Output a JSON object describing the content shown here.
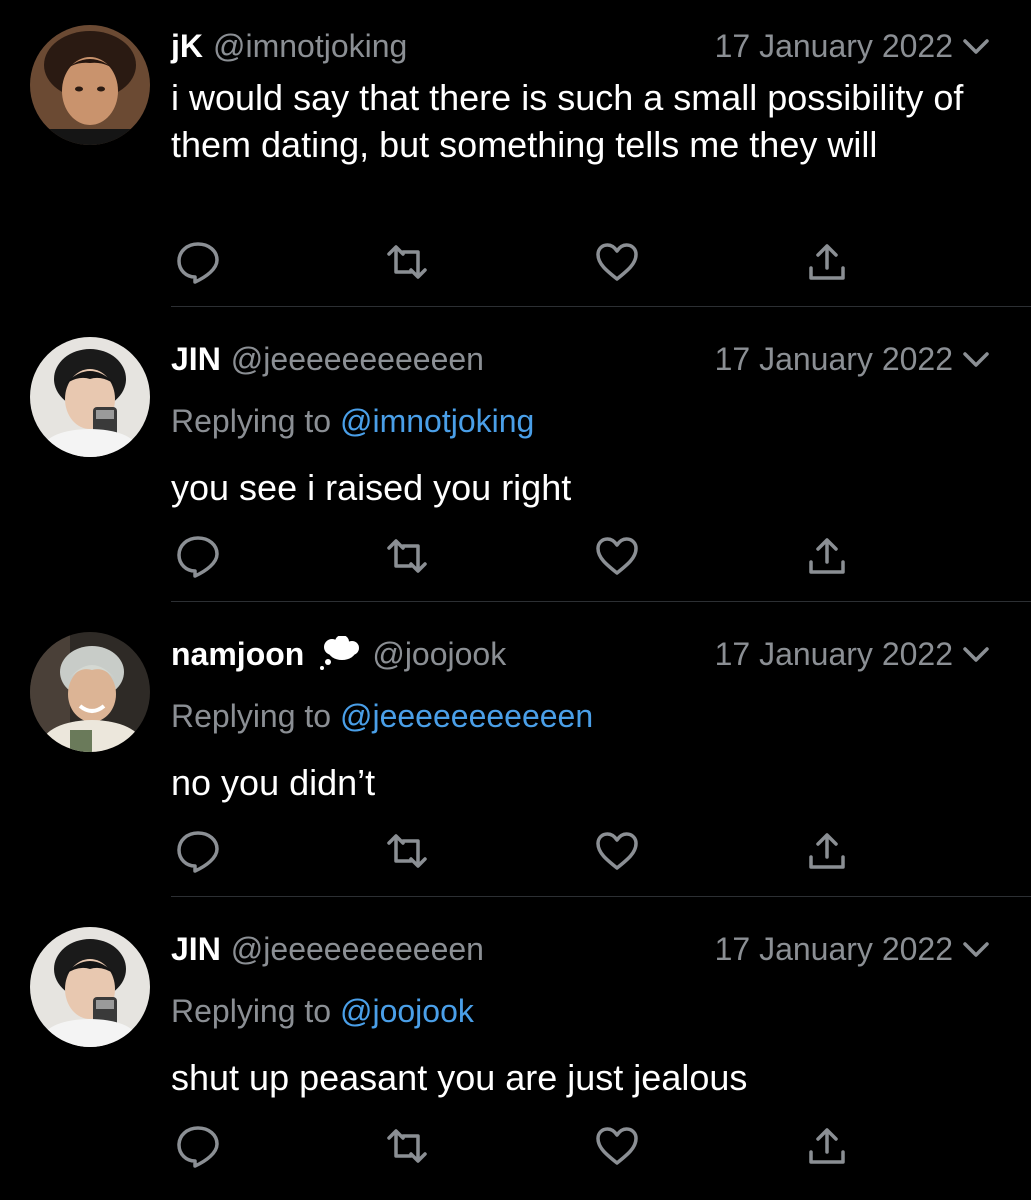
{
  "thread": {
    "tweets": [
      {
        "name": "jK",
        "handle": "@imnotjoking",
        "date": "17 January 2022",
        "replying_prefix": "",
        "replying_to": "",
        "text": "i would say that there is such a small possibility of them dating, but something tells me they will",
        "avatar": "avatar-jk",
        "badge": ""
      },
      {
        "name": "JIN",
        "handle": "@jeeeeeeeeeeen",
        "date": "17 January 2022",
        "replying_prefix": "Replying to",
        "replying_to": "@imnotjoking",
        "text": "you see i raised you right",
        "avatar": "avatar-jin"
      },
      {
        "name": "namjoon",
        "handle": "@joojook",
        "date": "17 January 2022",
        "replying_prefix": "Replying to",
        "replying_to": "@jeeeeeeeeeeen",
        "text": "no you didn’t",
        "avatar": "avatar-namjoon",
        "badge": "thought-bubble-icon"
      },
      {
        "name": "JIN",
        "handle": "@jeeeeeeeeeeen",
        "date": "17 January 2022",
        "replying_prefix": "Replying to",
        "replying_to": "@joojook",
        "text": "shut up peasant you are just jealous",
        "avatar": "avatar-jin"
      }
    ]
  },
  "actions": [
    "reply-icon",
    "retweet-icon",
    "like-icon",
    "share-icon"
  ],
  "colors": {
    "background": "#000000",
    "text": "#ffffff",
    "secondary": "#8b8f94",
    "mention": "#4a9fe8",
    "divider": "#2c2f33"
  }
}
